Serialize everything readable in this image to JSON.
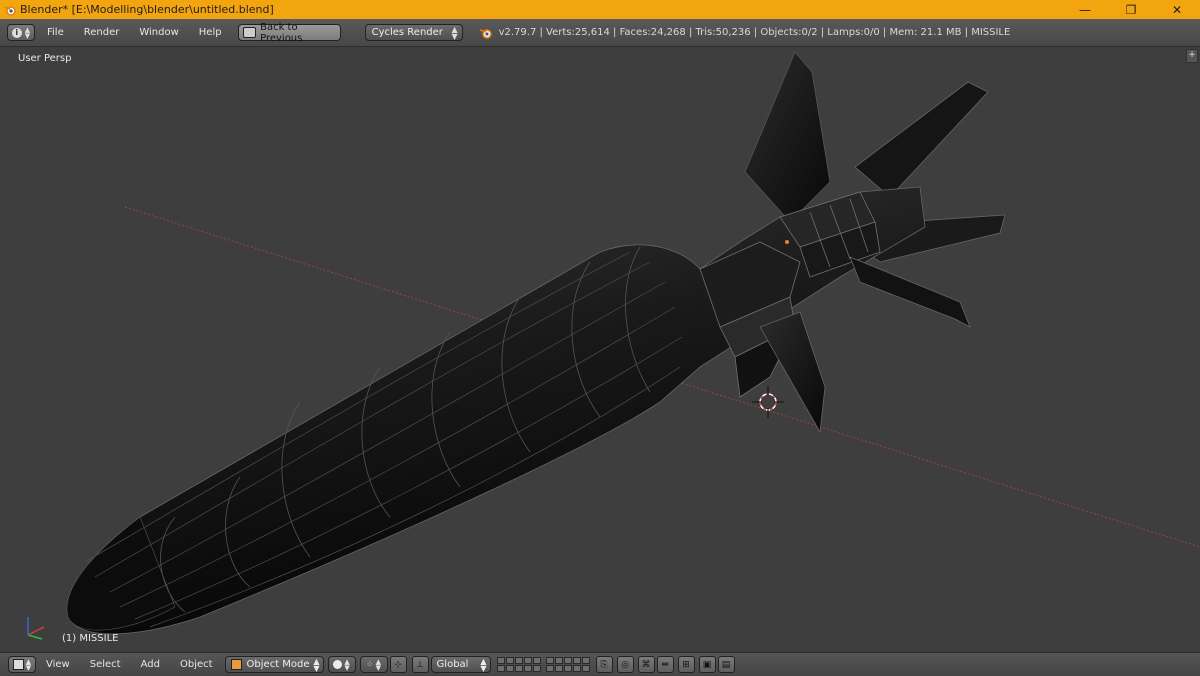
{
  "window": {
    "title": "Blender* [E:\\Modelling\\blender\\untitled.blend]",
    "controls": [
      "—",
      "❐",
      "✕"
    ]
  },
  "info_header": {
    "menus": [
      "File",
      "Render",
      "Window",
      "Help"
    ],
    "back_button": "Back to Previous",
    "render_engine": "Cycles Render",
    "stats": "v2.79.7 | Verts:25,614 | Faces:24,268 | Tris:50,236 | Objects:0/2 | Lamps:0/0 | Mem: 21.1 MB | MISSILE"
  },
  "viewport": {
    "view_label": "User Persp",
    "object_label": "(1) MISSILE"
  },
  "view3d_header": {
    "menus": [
      "View",
      "Select",
      "Add",
      "Object"
    ],
    "mode": "Object Mode",
    "orientation": "Global"
  },
  "colors": {
    "title_bar": "#f3a50f",
    "background": "#3e3e3e",
    "x_axis": "#a04040"
  }
}
